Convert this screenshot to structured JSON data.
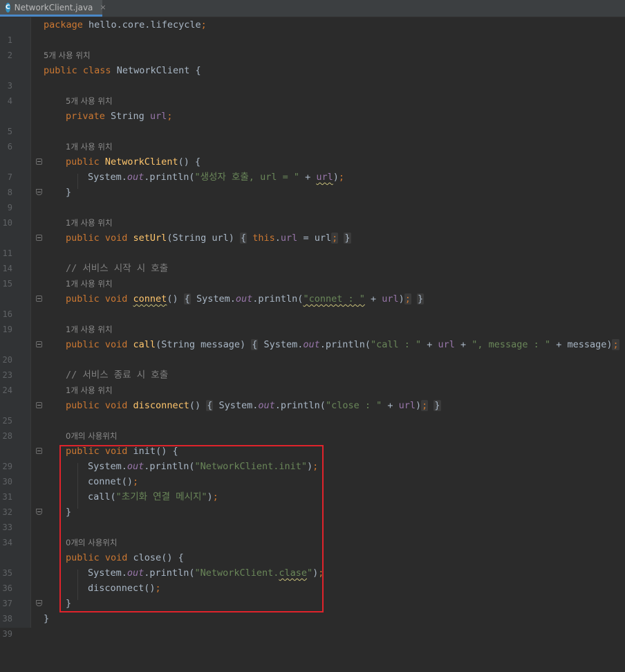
{
  "tab": {
    "icon_letter": "C",
    "filename": "NetworkClient.java",
    "close": "×"
  },
  "code": {
    "pkg": "package",
    "pkg_name": " hello.core.lifecycle",
    "semi": ";",
    "hint_class": "5개 사용 위치",
    "class_decl": {
      "public": "public",
      "class": " class",
      "name": " NetworkClient {"
    },
    "hint_url": "5개 사용 위치",
    "field": {
      "private": "private",
      "type": " String ",
      "name": "url",
      "semi": ";"
    },
    "hint_ctor": "1개 사용 위치",
    "ctor": {
      "public": "public",
      "name": " NetworkClient",
      "rest": "() {"
    },
    "ctor_body": {
      "sys": "System.",
      "out": "out",
      "println": ".println(",
      "str": "\"생성자 호출, url = \"",
      "plus": " + ",
      "url": "url",
      "close": ")",
      "semi": ";"
    },
    "brace": "}",
    "hint_seturl": "1개 사용 위치",
    "seturl": {
      "pv": "public void ",
      "name": "setUrl",
      "params": "(String url) ",
      "ob": "{",
      "this": " this",
      "dot": ".",
      "fld": "url",
      "assign": " = url",
      "semi": ";",
      "cb": "}"
    },
    "comment_start": "// 서비스 시작 시 호출",
    "hint_connet": "1개 사용 위치",
    "connet": {
      "pv": "public void ",
      "name": "connet",
      "paren": "() ",
      "ob": "{",
      "body_a": " System.",
      "out": "out",
      "body_b": ".println(",
      "str": "\"connet : \"",
      "plus": " + ",
      "url": "url",
      "close": ")",
      "semi": ";",
      "cb": "}"
    },
    "hint_call": "1개 사용 위치",
    "call": {
      "pv": "public void ",
      "name": "call",
      "params": "(String message) ",
      "ob": "{",
      "body_a": " System.",
      "out": "out",
      "body_b": ".println(",
      "str1": "\"call : \"",
      "p1": " + ",
      "url": "url",
      "p2": " + ",
      "str2": "\", message : \"",
      "p3": " + message)",
      "semi": ";",
      "cb": "}"
    },
    "comment_end": "// 서비스 종료 시 호출",
    "hint_disconnect": "1개 사용 위치",
    "disconnect": {
      "pv": "public void ",
      "name": "disconnect",
      "paren": "() ",
      "ob": "{",
      "body_a": " System.",
      "out": "out",
      "body_b": ".println(",
      "str": "\"close : \"",
      "plus": " + ",
      "url": "url",
      "close": ")",
      "semi": ";",
      "cb": "}"
    },
    "hint_init": "0개의 사용위치",
    "init": {
      "pv": "public void ",
      "name": "init",
      "rest": "() {"
    },
    "init_print": {
      "sys": "System.",
      "out": "out",
      "println": ".println(",
      "str": "\"NetworkClient.init\"",
      "close": ")",
      "semi": ";"
    },
    "init_connet": {
      "call": "connet()",
      "semi": ";"
    },
    "init_call": {
      "a": "call(",
      "str": "\"초기화 연결 메시지\"",
      "b": ")",
      "semi": ";"
    },
    "hint_close": "0개의 사용위치",
    "close_m": {
      "pv": "public void ",
      "name": "close",
      "rest": "() {"
    },
    "close_print": {
      "sys": "System.",
      "out": "out",
      "println": ".println(",
      "str_a": "\"NetworkClient.",
      "str_b": "clase",
      "str_c": "\"",
      "close": ")",
      "semi": ";"
    },
    "close_disc": {
      "call": "disconnect()",
      "semi": ";"
    }
  },
  "line_numbers": [
    "1",
    "2",
    "3",
    "4",
    "5",
    "6",
    "7",
    "8",
    "9",
    "10",
    "11",
    "14",
    "15",
    "16",
    "19",
    "20",
    "23",
    "24",
    "25",
    "28",
    "29",
    "30",
    "31",
    "32",
    "33",
    "34",
    "35",
    "36",
    "37",
    "38",
    "39"
  ]
}
